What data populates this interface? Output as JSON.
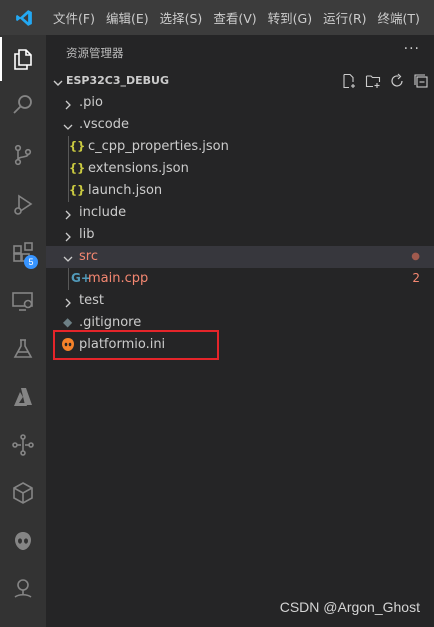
{
  "titlebar": {
    "app_icon": "vscode-logo",
    "menu": [
      "文件(F)",
      "编辑(E)",
      "选择(S)",
      "查看(V)",
      "转到(G)",
      "运行(R)",
      "终端(T)"
    ]
  },
  "activity_bar": {
    "items": [
      {
        "icon": "explorer-icon",
        "active": true
      },
      {
        "icon": "search-icon"
      },
      {
        "icon": "source-control-icon"
      },
      {
        "icon": "run-debug-icon"
      },
      {
        "icon": "extensions-icon",
        "badge": "5"
      },
      {
        "icon": "remote-explorer-icon"
      },
      {
        "icon": "testing-icon"
      },
      {
        "icon": "azure-icon"
      },
      {
        "icon": "tree-graph-icon"
      },
      {
        "icon": "cube-icon"
      },
      {
        "icon": "platformio-alien-icon"
      },
      {
        "icon": "hand-tree-icon"
      }
    ]
  },
  "sidebar": {
    "title": "资源管理器",
    "more": "···",
    "section": {
      "title": "ESP32C3_DEBUG",
      "actions": [
        "new-file-icon",
        "new-folder-icon",
        "refresh-icon",
        "collapse-all-icon"
      ]
    },
    "tree": [
      {
        "label": ".pio",
        "type": "folder",
        "depth": 0,
        "expanded": false
      },
      {
        "label": ".vscode",
        "type": "folder",
        "depth": 0,
        "expanded": true
      },
      {
        "label": "c_cpp_properties.json",
        "type": "json",
        "depth": 1
      },
      {
        "label": "extensions.json",
        "type": "json",
        "depth": 1
      },
      {
        "label": "launch.json",
        "type": "json",
        "depth": 1
      },
      {
        "label": "include",
        "type": "folder",
        "depth": 0,
        "expanded": false
      },
      {
        "label": "lib",
        "type": "folder",
        "depth": 0,
        "expanded": false
      },
      {
        "label": "src",
        "type": "folder",
        "depth": 0,
        "expanded": true,
        "error": true,
        "decoration": "●",
        "selected": true
      },
      {
        "label": "main.cpp",
        "type": "cpp",
        "depth": 1,
        "error": true,
        "decoration": "2"
      },
      {
        "label": "test",
        "type": "folder",
        "depth": 0,
        "expanded": false
      },
      {
        "label": ".gitignore",
        "type": "git",
        "depth": 0
      },
      {
        "label": "platformio.ini",
        "type": "platformio",
        "depth": 0,
        "highlighted": true
      }
    ]
  },
  "colors": {
    "error": "#f48771",
    "json_icon": "#cbcb41",
    "cpp_icon": "#519aba",
    "platformio_icon": "#f5822a",
    "highlight_box": "#e5252a",
    "badge": "#3794ff"
  },
  "watermark": "CSDN @Argon_Ghost"
}
